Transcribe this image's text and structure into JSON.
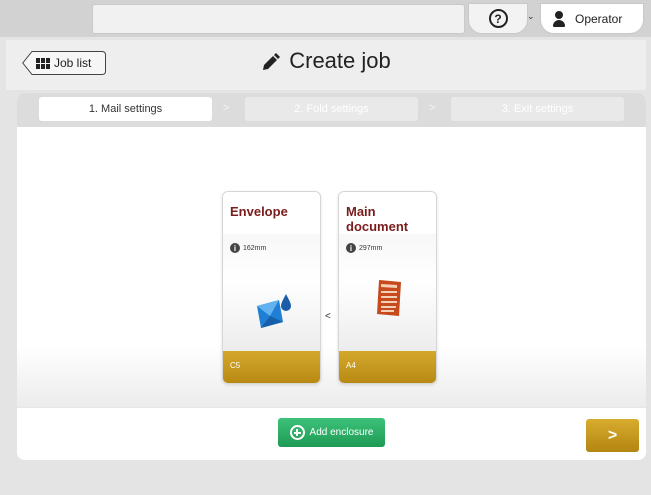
{
  "topbar": {
    "help_icon_glyph": "?",
    "user_dropdown_glyph": "⌄",
    "user_name": "Operator"
  },
  "header": {
    "back_label": "Job list",
    "title": "Create job"
  },
  "steps": [
    {
      "label": "1. Mail settings",
      "state": "active"
    },
    {
      "label": "2. Fold settings",
      "state": "inactive"
    },
    {
      "label": "3. Exit settings",
      "state": "inactive"
    }
  ],
  "step_separator": ">",
  "cards": [
    {
      "title": "Envelope",
      "size": "162mm",
      "format": "C5",
      "icon": "envelope-icon"
    },
    {
      "title": "Main document",
      "size": "297mm",
      "format": "A4",
      "icon": "document-icon"
    }
  ],
  "between_cards_glyph": "<",
  "bottom": {
    "add_label": "Add enclosure",
    "next_glyph": ">"
  },
  "colors": {
    "accent_gold": "#c69a1e",
    "card_title": "#7a1c1c",
    "add_green": "#2aae64"
  }
}
